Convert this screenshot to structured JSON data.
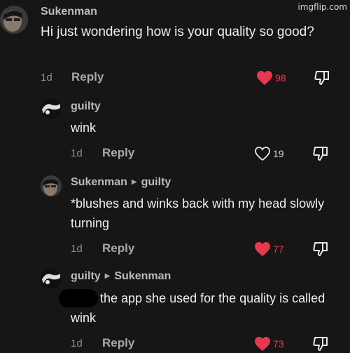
{
  "watermark": "imgflip.com",
  "colors": {
    "background": "#161616",
    "like_active": "#e63950",
    "text": "#efefef",
    "muted": "#8d8d8d"
  },
  "comments": [
    {
      "username": "Sukenman",
      "reply_to": "",
      "text": "Hi just wondering how is your quality so good?",
      "age": "1d",
      "reply_label": "Reply",
      "likes": "98",
      "liked": true,
      "avatar_icon": "profile-photo-icon",
      "dislike_icon": "thumbs-down-icon"
    },
    {
      "username": "guilty",
      "reply_to": "",
      "text": "wink",
      "age": "1d",
      "reply_label": "Reply",
      "likes": "19",
      "liked": false,
      "avatar_icon": "profile-photo-icon",
      "dislike_icon": "thumbs-down-icon"
    },
    {
      "username": "Sukenman",
      "reply_to": "guilty",
      "text": "*blushes and winks back with my head slowly turning",
      "age": "1d",
      "reply_label": "Reply",
      "likes": "77",
      "liked": true,
      "avatar_icon": "profile-photo-icon",
      "dislike_icon": "thumbs-down-icon"
    },
    {
      "username": "guilty",
      "reply_to": "Sukenman",
      "text": "the app she used for the quality is called wink",
      "age": "1d",
      "reply_label": "Reply",
      "likes": "73",
      "liked": true,
      "avatar_icon": "profile-photo-icon",
      "dislike_icon": "thumbs-down-icon"
    }
  ]
}
